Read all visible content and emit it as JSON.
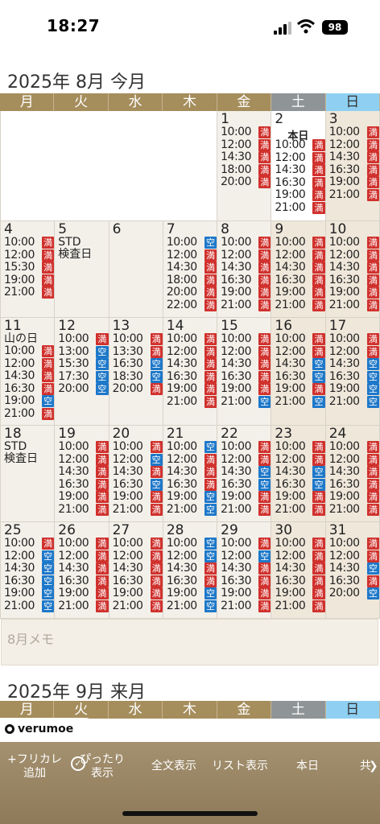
{
  "status_bar": {
    "time": "18:27",
    "battery": "98"
  },
  "month1": {
    "title": "2025年 8月 今月",
    "memo_placeholder": "8月メモ"
  },
  "month2": {
    "title": "2025年 9月 来月"
  },
  "weekdays": [
    "月",
    "火",
    "水",
    "木",
    "金",
    "土",
    "日"
  ],
  "today_label": "本日",
  "colors": {
    "full": "#d0312d",
    "vacant": "#1e78c9",
    "header": "#a58d5c",
    "saturday": "#8f9496",
    "sunday": "#8fd0f2"
  },
  "badges": {
    "full": "満",
    "vacant": "空"
  },
  "days": [
    {
      "day": "1",
      "note": "",
      "slots": [
        [
          "10:00",
          "満"
        ],
        [
          "12:00",
          "満"
        ],
        [
          "14:30",
          "満"
        ],
        [
          "18:00",
          "満"
        ],
        [
          "20:00",
          "満"
        ]
      ]
    },
    {
      "day": "2",
      "note": "",
      "today": true,
      "slots": [
        [
          "10:00",
          "満"
        ],
        [
          "12:00",
          "満"
        ],
        [
          "14:30",
          "満"
        ],
        [
          "16:30",
          "満"
        ],
        [
          "19:00",
          "満"
        ],
        [
          "21:00",
          "満"
        ]
      ]
    },
    {
      "day": "3",
      "note": "",
      "slots": [
        [
          "10:00",
          "満"
        ],
        [
          "12:00",
          "満"
        ],
        [
          "14:30",
          "満"
        ],
        [
          "16:30",
          "満"
        ],
        [
          "19:00",
          "満"
        ],
        [
          "21:00",
          "満"
        ]
      ]
    },
    {
      "day": "4",
      "note": "",
      "slots": [
        [
          "10:00",
          "満"
        ],
        [
          "12:00",
          "満"
        ],
        [
          "15:30",
          "満"
        ],
        [
          "19:00",
          "満"
        ],
        [
          "21:00",
          "満"
        ]
      ]
    },
    {
      "day": "5",
      "note": "STD\n検査日",
      "slots": []
    },
    {
      "day": "6",
      "note": "",
      "slots": []
    },
    {
      "day": "7",
      "note": "",
      "slots": [
        [
          "10:00",
          "空"
        ],
        [
          "12:00",
          "満"
        ],
        [
          "14:30",
          "満"
        ],
        [
          "18:00",
          "満"
        ],
        [
          "20:00",
          "満"
        ],
        [
          "22:00",
          "満"
        ]
      ]
    },
    {
      "day": "8",
      "note": "",
      "slots": [
        [
          "10:00",
          "満"
        ],
        [
          "12:00",
          "満"
        ],
        [
          "14:30",
          "満"
        ],
        [
          "16:30",
          "満"
        ],
        [
          "19:00",
          "満"
        ],
        [
          "21:00",
          "満"
        ]
      ]
    },
    {
      "day": "9",
      "note": "",
      "slots": [
        [
          "10:00",
          "満"
        ],
        [
          "12:00",
          "満"
        ],
        [
          "14:30",
          "満"
        ],
        [
          "16:30",
          "満"
        ],
        [
          "19:00",
          "満"
        ],
        [
          "21:00",
          "満"
        ]
      ]
    },
    {
      "day": "10",
      "note": "",
      "slots": [
        [
          "10:00",
          "満"
        ],
        [
          "12:00",
          "満"
        ],
        [
          "14:30",
          "満"
        ],
        [
          "16:30",
          "満"
        ],
        [
          "19:00",
          "満"
        ],
        [
          "21:00",
          "満"
        ]
      ]
    },
    {
      "day": "11",
      "note": "山の日",
      "slots": [
        [
          "10:00",
          "満"
        ],
        [
          "12:00",
          "満"
        ],
        [
          "14:30",
          "満"
        ],
        [
          "16:30",
          "満"
        ],
        [
          "19:00",
          "空"
        ],
        [
          "21:00",
          "満"
        ]
      ]
    },
    {
      "day": "12",
      "note": "",
      "slots": [
        [
          "10:00",
          "満"
        ],
        [
          "13:00",
          "空"
        ],
        [
          "15:30",
          "空"
        ],
        [
          "17:30",
          "空"
        ],
        [
          "20:00",
          "空"
        ]
      ]
    },
    {
      "day": "13",
      "note": "",
      "slots": [
        [
          "10:00",
          "満"
        ],
        [
          "13:30",
          "満"
        ],
        [
          "16:30",
          "空"
        ],
        [
          "18:30",
          "空"
        ],
        [
          "20:00",
          "満"
        ]
      ]
    },
    {
      "day": "14",
      "note": "",
      "slots": [
        [
          "10:00",
          "満"
        ],
        [
          "12:00",
          "満"
        ],
        [
          "14:30",
          "満"
        ],
        [
          "16:30",
          "満"
        ],
        [
          "19:00",
          "満"
        ],
        [
          "21:00",
          "満"
        ]
      ]
    },
    {
      "day": "15",
      "note": "",
      "slots": [
        [
          "10:00",
          "満"
        ],
        [
          "12:00",
          "満"
        ],
        [
          "14:30",
          "満"
        ],
        [
          "16:30",
          "満"
        ],
        [
          "19:00",
          "満"
        ],
        [
          "21:00",
          "空"
        ]
      ]
    },
    {
      "day": "16",
      "note": "",
      "slots": [
        [
          "10:00",
          "満"
        ],
        [
          "12:00",
          "満"
        ],
        [
          "14:30",
          "空"
        ],
        [
          "16:30",
          "空"
        ],
        [
          "19:00",
          "満"
        ],
        [
          "21:00",
          "空"
        ]
      ]
    },
    {
      "day": "17",
      "note": "",
      "slots": [
        [
          "10:00",
          "満"
        ],
        [
          "12:00",
          "満"
        ],
        [
          "14:30",
          "空"
        ],
        [
          "16:30",
          "空"
        ],
        [
          "19:00",
          "空"
        ],
        [
          "21:00",
          "空"
        ]
      ]
    },
    {
      "day": "18",
      "note": "STD\n検査日",
      "slots": []
    },
    {
      "day": "19",
      "note": "",
      "slots": [
        [
          "10:00",
          "満"
        ],
        [
          "12:00",
          "満"
        ],
        [
          "14:30",
          "満"
        ],
        [
          "16:30",
          "満"
        ],
        [
          "19:00",
          "満"
        ],
        [
          "21:00",
          "満"
        ]
      ]
    },
    {
      "day": "20",
      "note": "",
      "slots": [
        [
          "10:00",
          "満"
        ],
        [
          "12:00",
          "空"
        ],
        [
          "14:30",
          "満"
        ],
        [
          "16:30",
          "空"
        ],
        [
          "19:00",
          "満"
        ],
        [
          "21:00",
          "満"
        ]
      ]
    },
    {
      "day": "21",
      "note": "",
      "slots": [
        [
          "10:00",
          "空"
        ],
        [
          "12:00",
          "満"
        ],
        [
          "14:30",
          "満"
        ],
        [
          "16:30",
          "満"
        ],
        [
          "19:00",
          "空"
        ],
        [
          "21:00",
          "空"
        ]
      ]
    },
    {
      "day": "22",
      "note": "",
      "slots": [
        [
          "10:00",
          "満"
        ],
        [
          "12:00",
          "満"
        ],
        [
          "14:30",
          "空"
        ],
        [
          "16:30",
          "空"
        ],
        [
          "19:00",
          "満"
        ],
        [
          "21:00",
          "満"
        ]
      ]
    },
    {
      "day": "23",
      "note": "",
      "slots": [
        [
          "10:00",
          "満"
        ],
        [
          "12:00",
          "満"
        ],
        [
          "14:30",
          "空"
        ],
        [
          "16:30",
          "空"
        ],
        [
          "19:00",
          "満"
        ],
        [
          "21:00",
          "満"
        ]
      ]
    },
    {
      "day": "24",
      "note": "",
      "slots": [
        [
          "10:00",
          "満"
        ],
        [
          "12:00",
          "満"
        ],
        [
          "14:30",
          "満"
        ],
        [
          "16:30",
          "満"
        ],
        [
          "19:00",
          "満"
        ],
        [
          "21:00",
          "満"
        ]
      ]
    },
    {
      "day": "25",
      "note": "",
      "slots": [
        [
          "10:00",
          "満"
        ],
        [
          "12:00",
          "空"
        ],
        [
          "14:30",
          "空"
        ],
        [
          "16:30",
          "空"
        ],
        [
          "19:00",
          "空"
        ],
        [
          "21:00",
          "空"
        ]
      ]
    },
    {
      "day": "26",
      "note": "",
      "slots": [
        [
          "10:00",
          "満"
        ],
        [
          "12:00",
          "満"
        ],
        [
          "14:30",
          "満"
        ],
        [
          "16:30",
          "満"
        ],
        [
          "19:00",
          "満"
        ],
        [
          "21:00",
          "満"
        ]
      ]
    },
    {
      "day": "27",
      "note": "",
      "slots": [
        [
          "10:00",
          "満"
        ],
        [
          "12:00",
          "満"
        ],
        [
          "14:30",
          "満"
        ],
        [
          "16:30",
          "満"
        ],
        [
          "19:00",
          "満"
        ],
        [
          "21:00",
          "満"
        ]
      ]
    },
    {
      "day": "28",
      "note": "",
      "slots": [
        [
          "10:00",
          "空"
        ],
        [
          "12:00",
          "空"
        ],
        [
          "14:30",
          "満"
        ],
        [
          "16:30",
          "満"
        ],
        [
          "19:00",
          "空"
        ],
        [
          "21:00",
          "空"
        ]
      ]
    },
    {
      "day": "29",
      "note": "",
      "slots": [
        [
          "10:00",
          "満"
        ],
        [
          "12:00",
          "空"
        ],
        [
          "14:30",
          "満"
        ],
        [
          "16:30",
          "満"
        ],
        [
          "19:00",
          "満"
        ],
        [
          "21:00",
          "満"
        ]
      ]
    },
    {
      "day": "30",
      "note": "",
      "slots": [
        [
          "10:00",
          "満"
        ],
        [
          "12:00",
          "満"
        ],
        [
          "14:30",
          "満"
        ],
        [
          "16:30",
          "満"
        ],
        [
          "19:00",
          "満"
        ],
        [
          "21:00",
          "満"
        ]
      ]
    },
    {
      "day": "31",
      "note": "",
      "slots": [
        [
          "10:00",
          "満"
        ],
        [
          "12:00",
          "満"
        ],
        [
          "14:30",
          "空"
        ],
        [
          "16:30",
          "満"
        ],
        [
          "20:00",
          "空"
        ]
      ]
    }
  ],
  "brand": "verumoe",
  "toolbar": [
    {
      "label": "+フリカレ\n追加",
      "name": "add-furikare-button"
    },
    {
      "label": "ぴったり\n表示",
      "name": "fit-view-button"
    },
    {
      "label": "全文表示",
      "name": "full-text-button"
    },
    {
      "label": "リスト表示",
      "name": "list-view-button"
    },
    {
      "label": "本日",
      "name": "today-button"
    },
    {
      "label": "共",
      "name": "share-button"
    }
  ]
}
